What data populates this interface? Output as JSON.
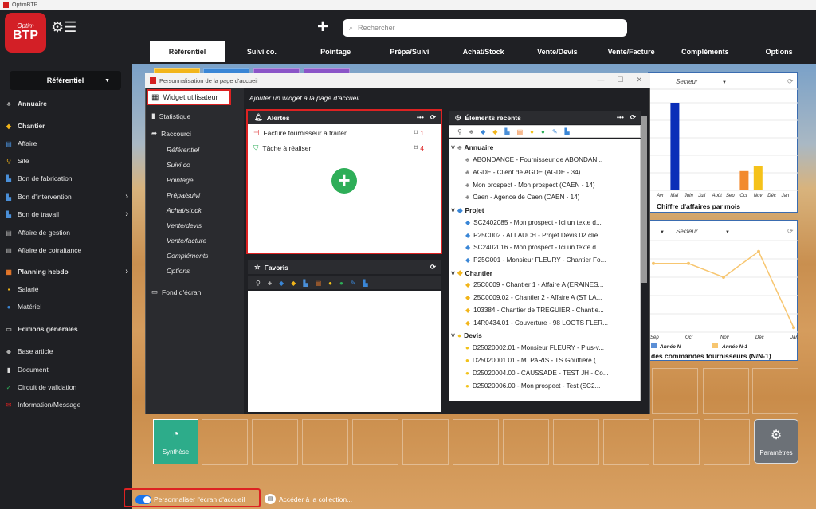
{
  "app": {
    "name": "OptimBTP",
    "logo_top": "Optim",
    "logo_bottom": "BTP"
  },
  "header": {
    "search_placeholder": "Rechercher",
    "plus_symbol": "+"
  },
  "nav": [
    "Référentiel",
    "Suivi co.",
    "Pointage",
    "Prépa/Suivi",
    "Achat/Stock",
    "Vente/Devis",
    "Vente/Facture",
    "Compléments",
    "Options"
  ],
  "sidebar": {
    "selector": "Référentiel",
    "items": [
      {
        "label": "Annuaire",
        "bold": true
      },
      {
        "label": "Chantier",
        "bold": true
      },
      {
        "label": "Affaire"
      },
      {
        "label": "Site"
      },
      {
        "label": "Bon de fabrication"
      },
      {
        "label": "Bon d'intervention"
      },
      {
        "label": "Bon de travail"
      },
      {
        "label": "Affaire de gestion"
      },
      {
        "label": "Affaire de cotraitance"
      },
      {
        "label": "Planning hebdo",
        "bold": true
      },
      {
        "label": "Salarié"
      },
      {
        "label": "Matériel"
      },
      {
        "label": "Editions générales",
        "bold": true
      },
      {
        "label": "Base article"
      },
      {
        "label": "Document"
      },
      {
        "label": "Circuit de validation"
      },
      {
        "label": "Information/Message"
      }
    ]
  },
  "charts": {
    "left": {
      "filter": "Secteur",
      "title": "Chiffre d'affaires par mois",
      "type": "bar",
      "categories": [
        "Avr",
        "Mai",
        "Juin",
        "Juil",
        "Août",
        "Sep",
        "Oct",
        "Nov",
        "Déc",
        "Jan"
      ],
      "values_blue": [
        0,
        100,
        0,
        0,
        0,
        0,
        0,
        0,
        0,
        0
      ],
      "values_orange": [
        0,
        0,
        0,
        0,
        0,
        0,
        22,
        0,
        0,
        0
      ],
      "values_yellow": [
        0,
        0,
        0,
        0,
        0,
        0,
        0,
        28,
        0,
        0
      ]
    },
    "right": {
      "filter": "Secteur",
      "title": "des commandes fournisseurs (N/N-1)",
      "type": "line",
      "categories": [
        "Sep",
        "Oct",
        "Nov",
        "Déc",
        "Jan"
      ],
      "series_n1": [
        75,
        75,
        60,
        88,
        5
      ],
      "legend": [
        "Année N",
        "Année N-1"
      ]
    }
  },
  "tiles": {
    "synthese": "Synthèse",
    "parametres": "Paramètres"
  },
  "bottom": {
    "personalize": "Personnaliser l'écran d'accueil",
    "collection": "Accéder à la collection..."
  },
  "dialog": {
    "title": "Personnalisation de la page d'accueil",
    "tabs": {
      "widget": "Widget utilisateur",
      "stat": "Statistique",
      "raccourci": "Raccourci",
      "fond": "Fond d'écran"
    },
    "shortcuts": [
      "Référentiel",
      "Suivi co",
      "Pointage",
      "Prépa/suivi",
      "Achat/stock",
      "Vente/devis",
      "Vente/facture",
      "Compléments",
      "Options"
    ],
    "add_label": "Ajouter un widget à la page d'accueil",
    "alerts": {
      "title": "Alertes",
      "rows": [
        {
          "label": "Facture fournisseur à traiter",
          "count": "1"
        },
        {
          "label": "Tâche à réaliser",
          "count": "4"
        }
      ]
    },
    "favoris": {
      "title": "Favoris"
    },
    "recents": {
      "title": "Éléments récents",
      "groups": [
        {
          "name": "Annuaire",
          "items": [
            "ABONDANCE - Fournisseur de ABONDAN...",
            "AGDE - Client de AGDE (AGDE - 34)",
            "Mon prospect - Mon prospect (CAEN - 14)",
            "Caen - Agence de Caen (CAEN - 14)"
          ]
        },
        {
          "name": "Projet",
          "items": [
            "SC2402085 - Mon prospect - Ici un texte d...",
            "P25C002 - ALLAUCH - Projet Devis 02 clie...",
            "SC2402016 - Mon prospect - Ici un texte d...",
            "P25C001 - Monsieur FLEURY - Chantier Fo..."
          ]
        },
        {
          "name": "Chantier",
          "items": [
            "25C0009 - Chantier 1 - Affaire A (ERAINES...",
            "25C0009.02 - Chantier 2 - Affaire A (ST LA...",
            "103384 - Chantier de TREGUIER - Chantie...",
            "14R0434.01 - Couverture - 98 LOGTS FLER..."
          ]
        },
        {
          "name": "Devis",
          "items": [
            "D25020002.01 - Monsieur FLEURY - Plus-v...",
            "D25020001.01 - M. PARIS - TS Gouttière (...",
            "D25020004.00 - CAUSSADE - TEST JH - Co...",
            "D25020006.00 - Mon prospect - Test (SC2..."
          ]
        }
      ]
    }
  }
}
